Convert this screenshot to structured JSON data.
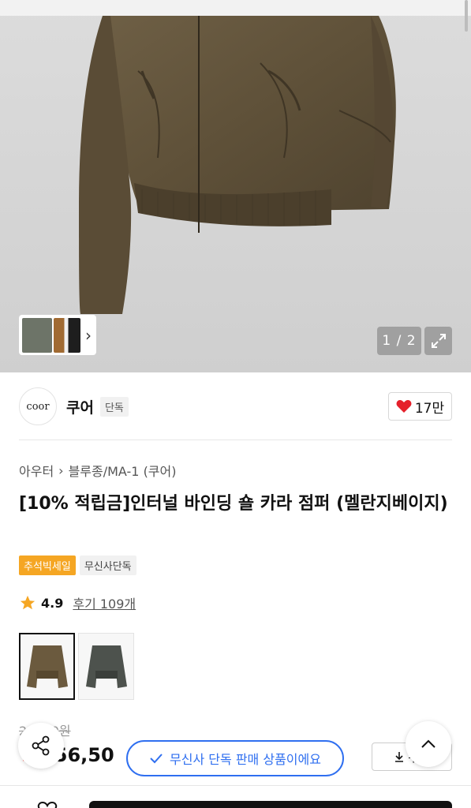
{
  "gallery": {
    "page_counter": "1 / 2",
    "icons": {
      "expand": "expand-icon",
      "next": "chevron-right-icon"
    }
  },
  "brand": {
    "logo_text": "coor",
    "name": "쿠어",
    "tag": "단독",
    "like_count": "17만"
  },
  "breadcrumb": {
    "items": [
      "아우터",
      "블루종/MA-1 (쿠어)"
    ]
  },
  "product": {
    "title": "[10% 적립금]인터널 바인딩 숄 카라 점퍼 (멜란지베이지)",
    "badges": [
      "추석빅세일",
      "무신사단독"
    ],
    "rating": "4.9",
    "review_text": "후기 109개",
    "original_price": "2   ,000원",
    "discount": "%",
    "sale_price": "256,50"
  },
  "coupon": {
    "label": "쿠폰"
  },
  "toast": {
    "text": "무신사 단독 판매 상품이에요"
  },
  "colors": {
    "accent": "#2f6ff0",
    "sale_badge": "#f5a623",
    "heart": "#e5202b",
    "discount": "#ff3b30"
  }
}
